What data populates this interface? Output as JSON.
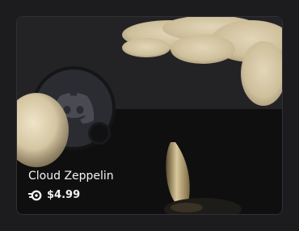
{
  "item": {
    "name": "Cloud Zeppelin",
    "price": "$4.99",
    "currency_icon": "orb-icon",
    "avatar_icon": "discord-icon"
  },
  "colors": {
    "card_bg": "#0f0f10",
    "sky_band": "#232326",
    "cloud": "#d9cbab",
    "text": "#f2f3f5",
    "avatar_bg": "#2b2c31"
  }
}
